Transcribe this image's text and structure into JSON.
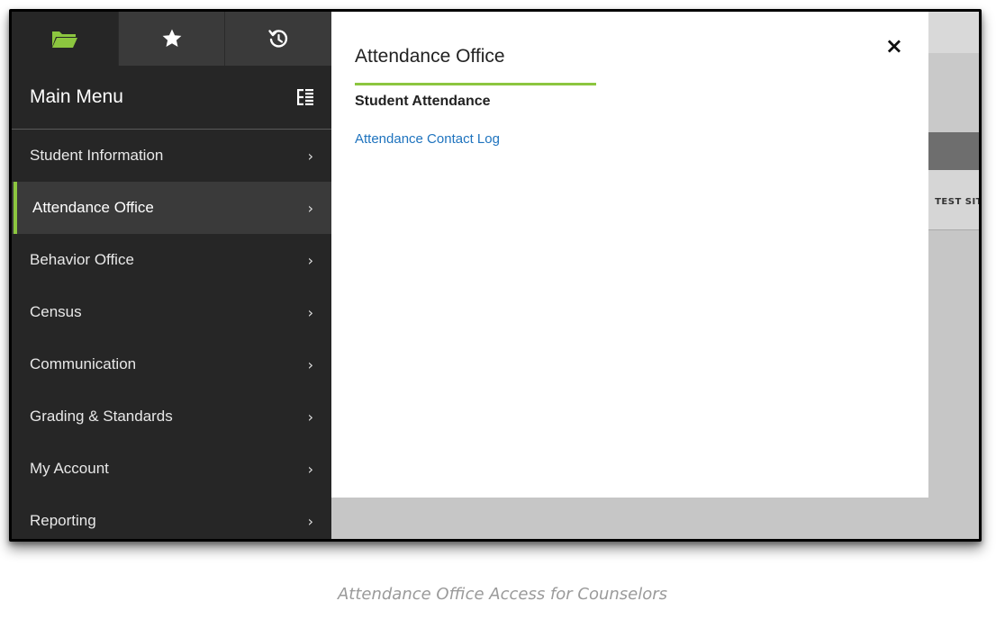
{
  "colors": {
    "accent": "#8cc63f",
    "link": "#1e73be",
    "nav_background": "#262626",
    "nav_active": "#3a3a3a"
  },
  "nav": {
    "tabs": [
      {
        "icon": "folder-open-icon",
        "active": true
      },
      {
        "icon": "star-icon",
        "active": false
      },
      {
        "icon": "history-icon",
        "active": false
      }
    ],
    "title": "Main Menu",
    "header_icon": "tree-list-icon",
    "items": [
      {
        "label": "Student Information",
        "active": false
      },
      {
        "label": "Attendance Office",
        "active": true
      },
      {
        "label": "Behavior Office",
        "active": false
      },
      {
        "label": "Census",
        "active": false
      },
      {
        "label": "Communication",
        "active": false
      },
      {
        "label": "Grading & Standards",
        "active": false
      },
      {
        "label": "My Account",
        "active": false
      },
      {
        "label": "Reporting",
        "active": false
      }
    ]
  },
  "flyout": {
    "title": "Attendance Office",
    "close_label": "×",
    "section_heading": "Student Attendance",
    "links": [
      "Attendance Contact Log"
    ]
  },
  "background": {
    "column_label": "TEST SIT"
  },
  "caption": "Attendance Office Access for Counselors"
}
